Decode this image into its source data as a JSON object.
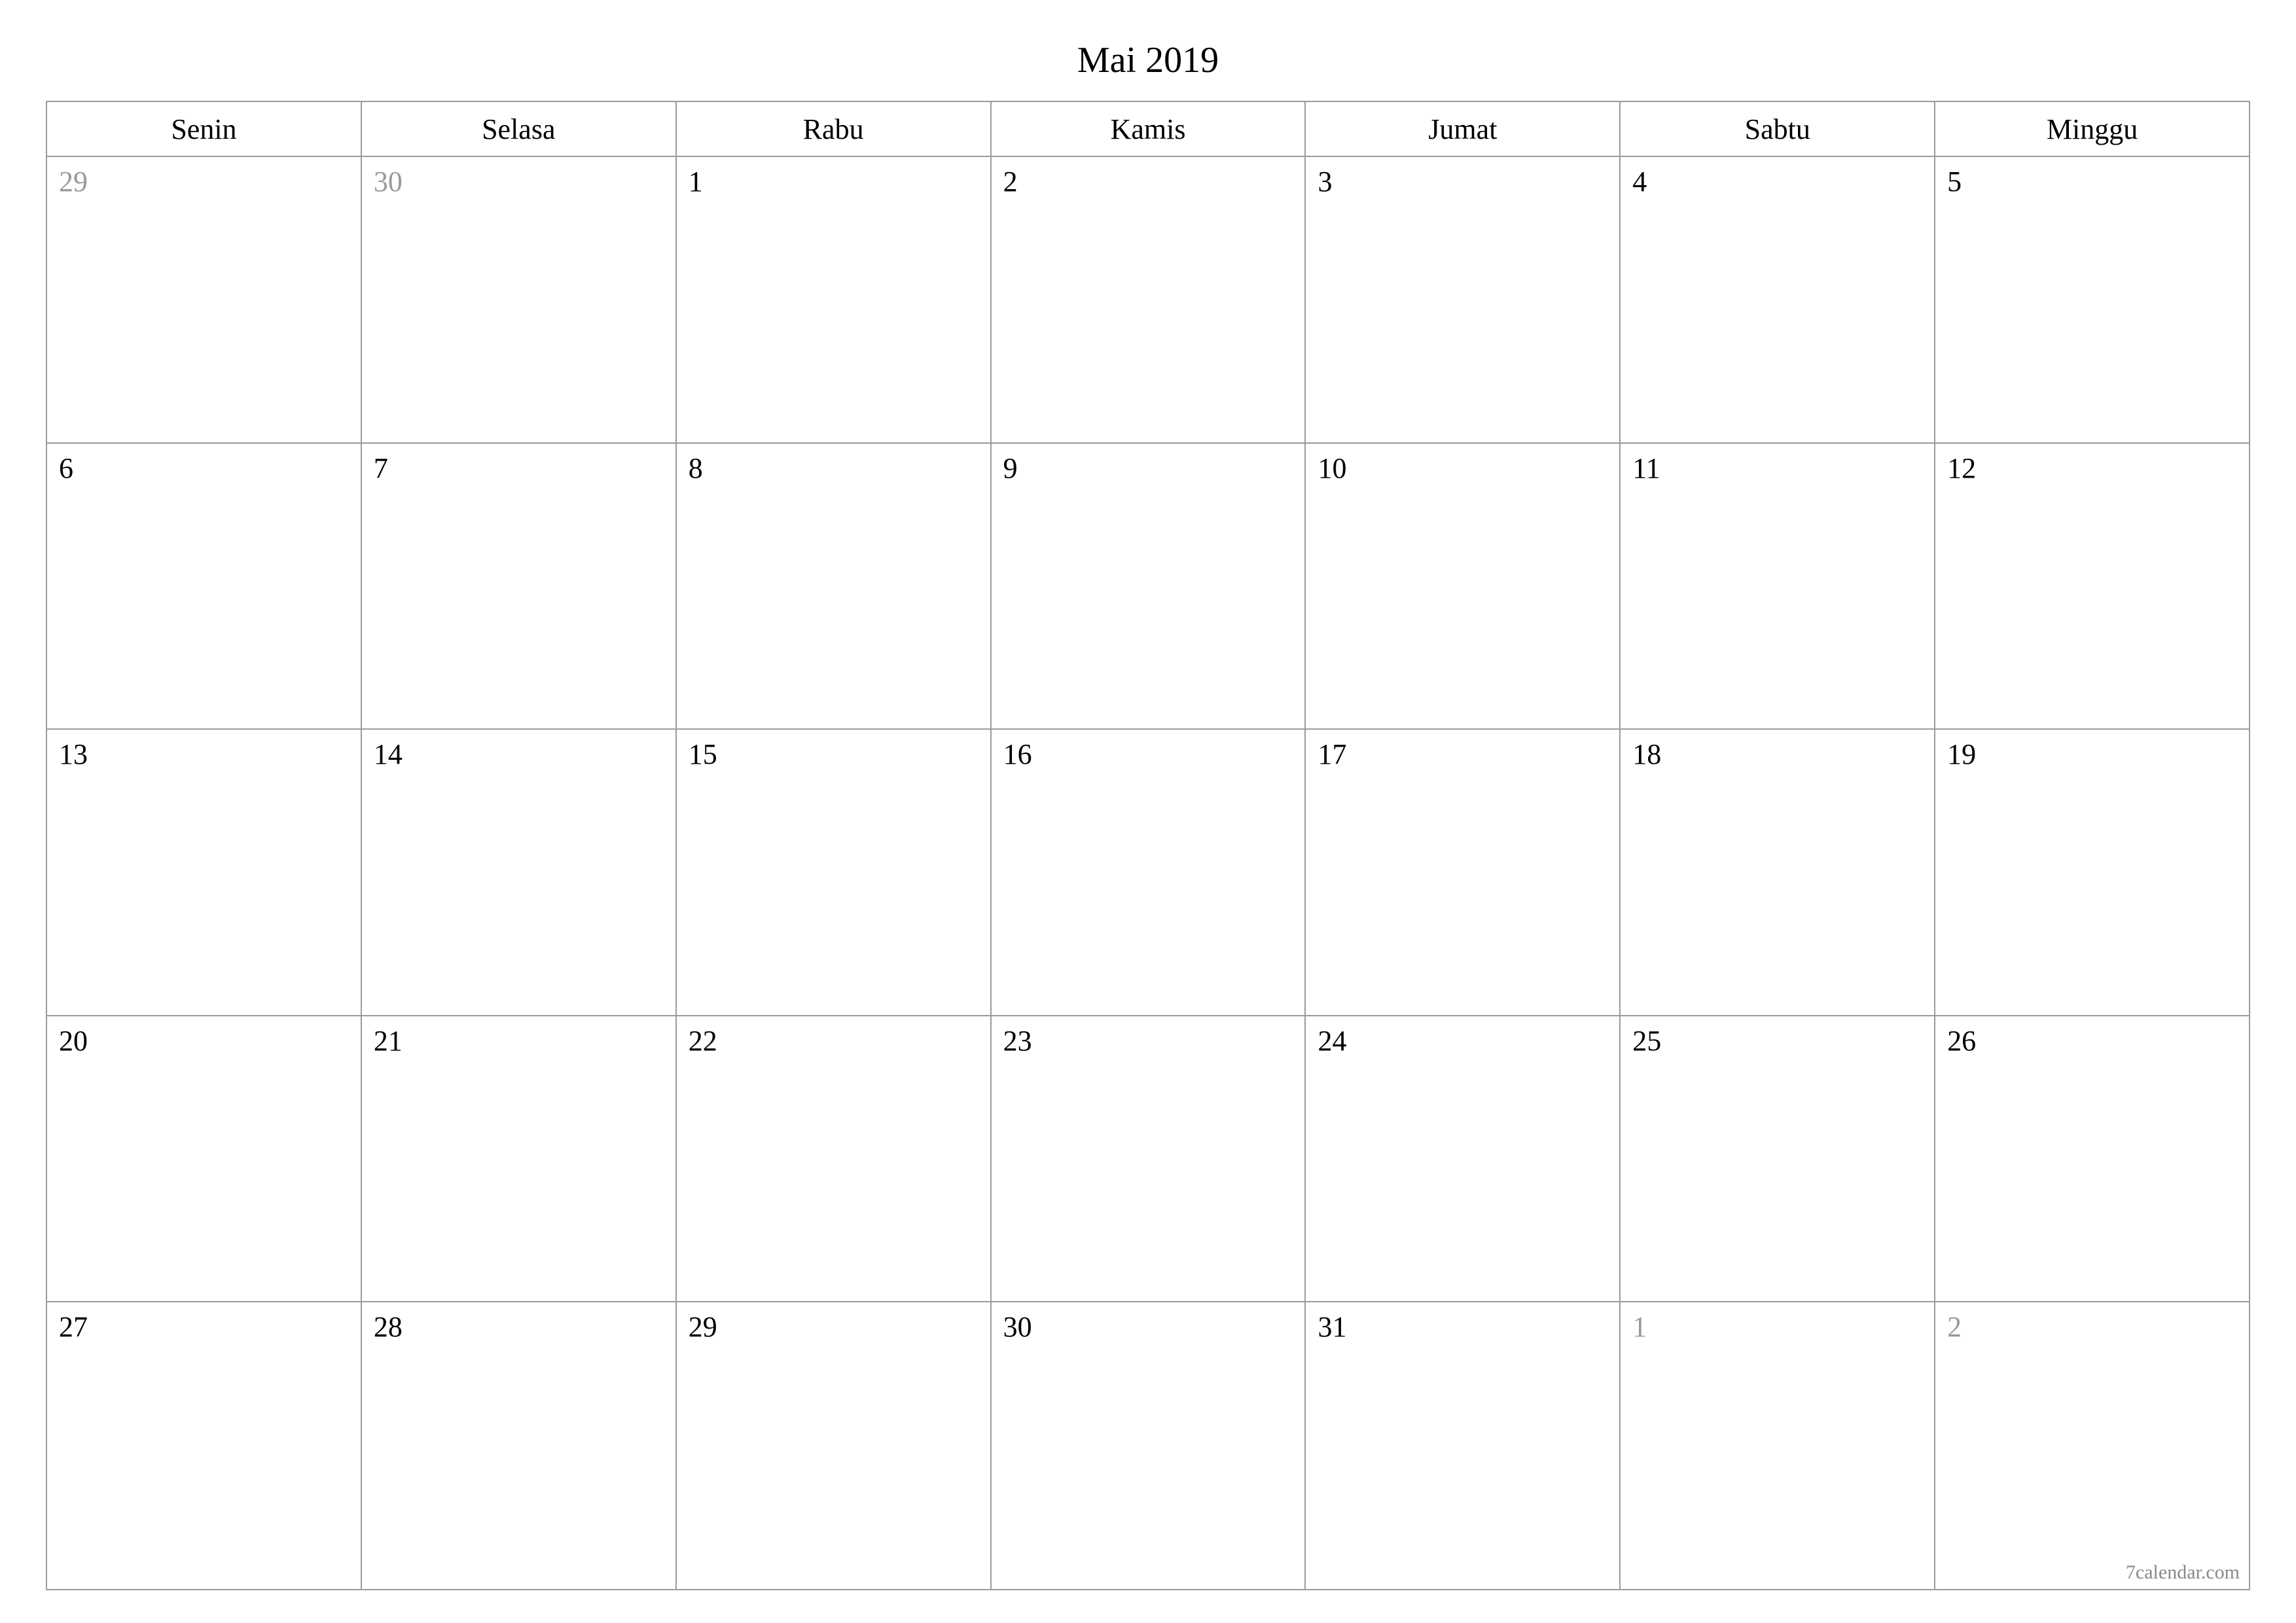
{
  "title": "Mai 2019",
  "weekdays": [
    "Senin",
    "Selasa",
    "Rabu",
    "Kamis",
    "Jumat",
    "Sabtu",
    "Minggu"
  ],
  "weeks": [
    [
      {
        "day": "29",
        "other": true
      },
      {
        "day": "30",
        "other": true
      },
      {
        "day": "1",
        "other": false
      },
      {
        "day": "2",
        "other": false
      },
      {
        "day": "3",
        "other": false
      },
      {
        "day": "4",
        "other": false
      },
      {
        "day": "5",
        "other": false
      }
    ],
    [
      {
        "day": "6",
        "other": false
      },
      {
        "day": "7",
        "other": false
      },
      {
        "day": "8",
        "other": false
      },
      {
        "day": "9",
        "other": false
      },
      {
        "day": "10",
        "other": false
      },
      {
        "day": "11",
        "other": false
      },
      {
        "day": "12",
        "other": false
      }
    ],
    [
      {
        "day": "13",
        "other": false
      },
      {
        "day": "14",
        "other": false
      },
      {
        "day": "15",
        "other": false
      },
      {
        "day": "16",
        "other": false
      },
      {
        "day": "17",
        "other": false
      },
      {
        "day": "18",
        "other": false
      },
      {
        "day": "19",
        "other": false
      }
    ],
    [
      {
        "day": "20",
        "other": false
      },
      {
        "day": "21",
        "other": false
      },
      {
        "day": "22",
        "other": false
      },
      {
        "day": "23",
        "other": false
      },
      {
        "day": "24",
        "other": false
      },
      {
        "day": "25",
        "other": false
      },
      {
        "day": "26",
        "other": false
      }
    ],
    [
      {
        "day": "27",
        "other": false
      },
      {
        "day": "28",
        "other": false
      },
      {
        "day": "29",
        "other": false
      },
      {
        "day": "30",
        "other": false
      },
      {
        "day": "31",
        "other": false
      },
      {
        "day": "1",
        "other": true
      },
      {
        "day": "2",
        "other": true
      }
    ]
  ],
  "credit": "7calendar.com"
}
